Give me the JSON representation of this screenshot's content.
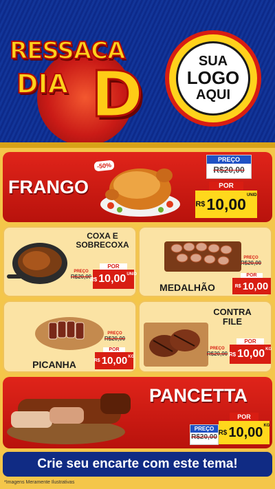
{
  "header": {
    "title_line1": "RESSACA",
    "title_line2": "DIA",
    "title_letter": "D",
    "logo_text": [
      "SUA",
      "LOGO",
      "AQUI"
    ]
  },
  "products": {
    "frango": {
      "name": "FRANGO",
      "discount": "-50%",
      "preco_label": "PREÇO",
      "old_price": "R$20,00",
      "por_label": "POR",
      "currency": "R$",
      "price": "10,00",
      "unit": "UNID"
    },
    "coxa": {
      "name_line1": "COXA E",
      "name_line2": "SOBRECOXA",
      "preco_label": "PREÇO",
      "old_price": "R$20,00",
      "por_label": "POR",
      "currency": "R$",
      "price": "10,00",
      "unit": "UNID"
    },
    "medalhao": {
      "name": "MEDALHÃO",
      "preco_label": "PREÇO",
      "old_price": "R$20,00",
      "por_label": "POR",
      "currency": "R$",
      "price": "10,00"
    },
    "picanha": {
      "name": "PICANHA",
      "preco_label": "PREÇO",
      "old_price": "R$20,00",
      "por_label": "POR",
      "currency": "R$",
      "price": "10,00",
      "unit": "KG"
    },
    "contrafile": {
      "name_line1": "CONTRA",
      "name_line2": "FILE",
      "preco_label": "PREÇO",
      "old_price": "R$20,00",
      "por_label": "POR",
      "currency": "R$",
      "price": "10,00",
      "unit": "KG"
    },
    "pancetta": {
      "name": "PANCETTA",
      "preco_label": "PREÇO",
      "old_price": "R$20,00",
      "por_label": "POR",
      "currency": "R$",
      "price": "10,00",
      "unit": "KG"
    }
  },
  "footer": {
    "cta": "Crie seu encarte com este tema!",
    "disclaimer": "*Imagens Meramente Ilustrativas"
  },
  "colors": {
    "brand_blue": "#102b84",
    "brand_red": "#d81d12",
    "brand_yellow": "#ffd81c",
    "cream": "#fbe3a4"
  }
}
